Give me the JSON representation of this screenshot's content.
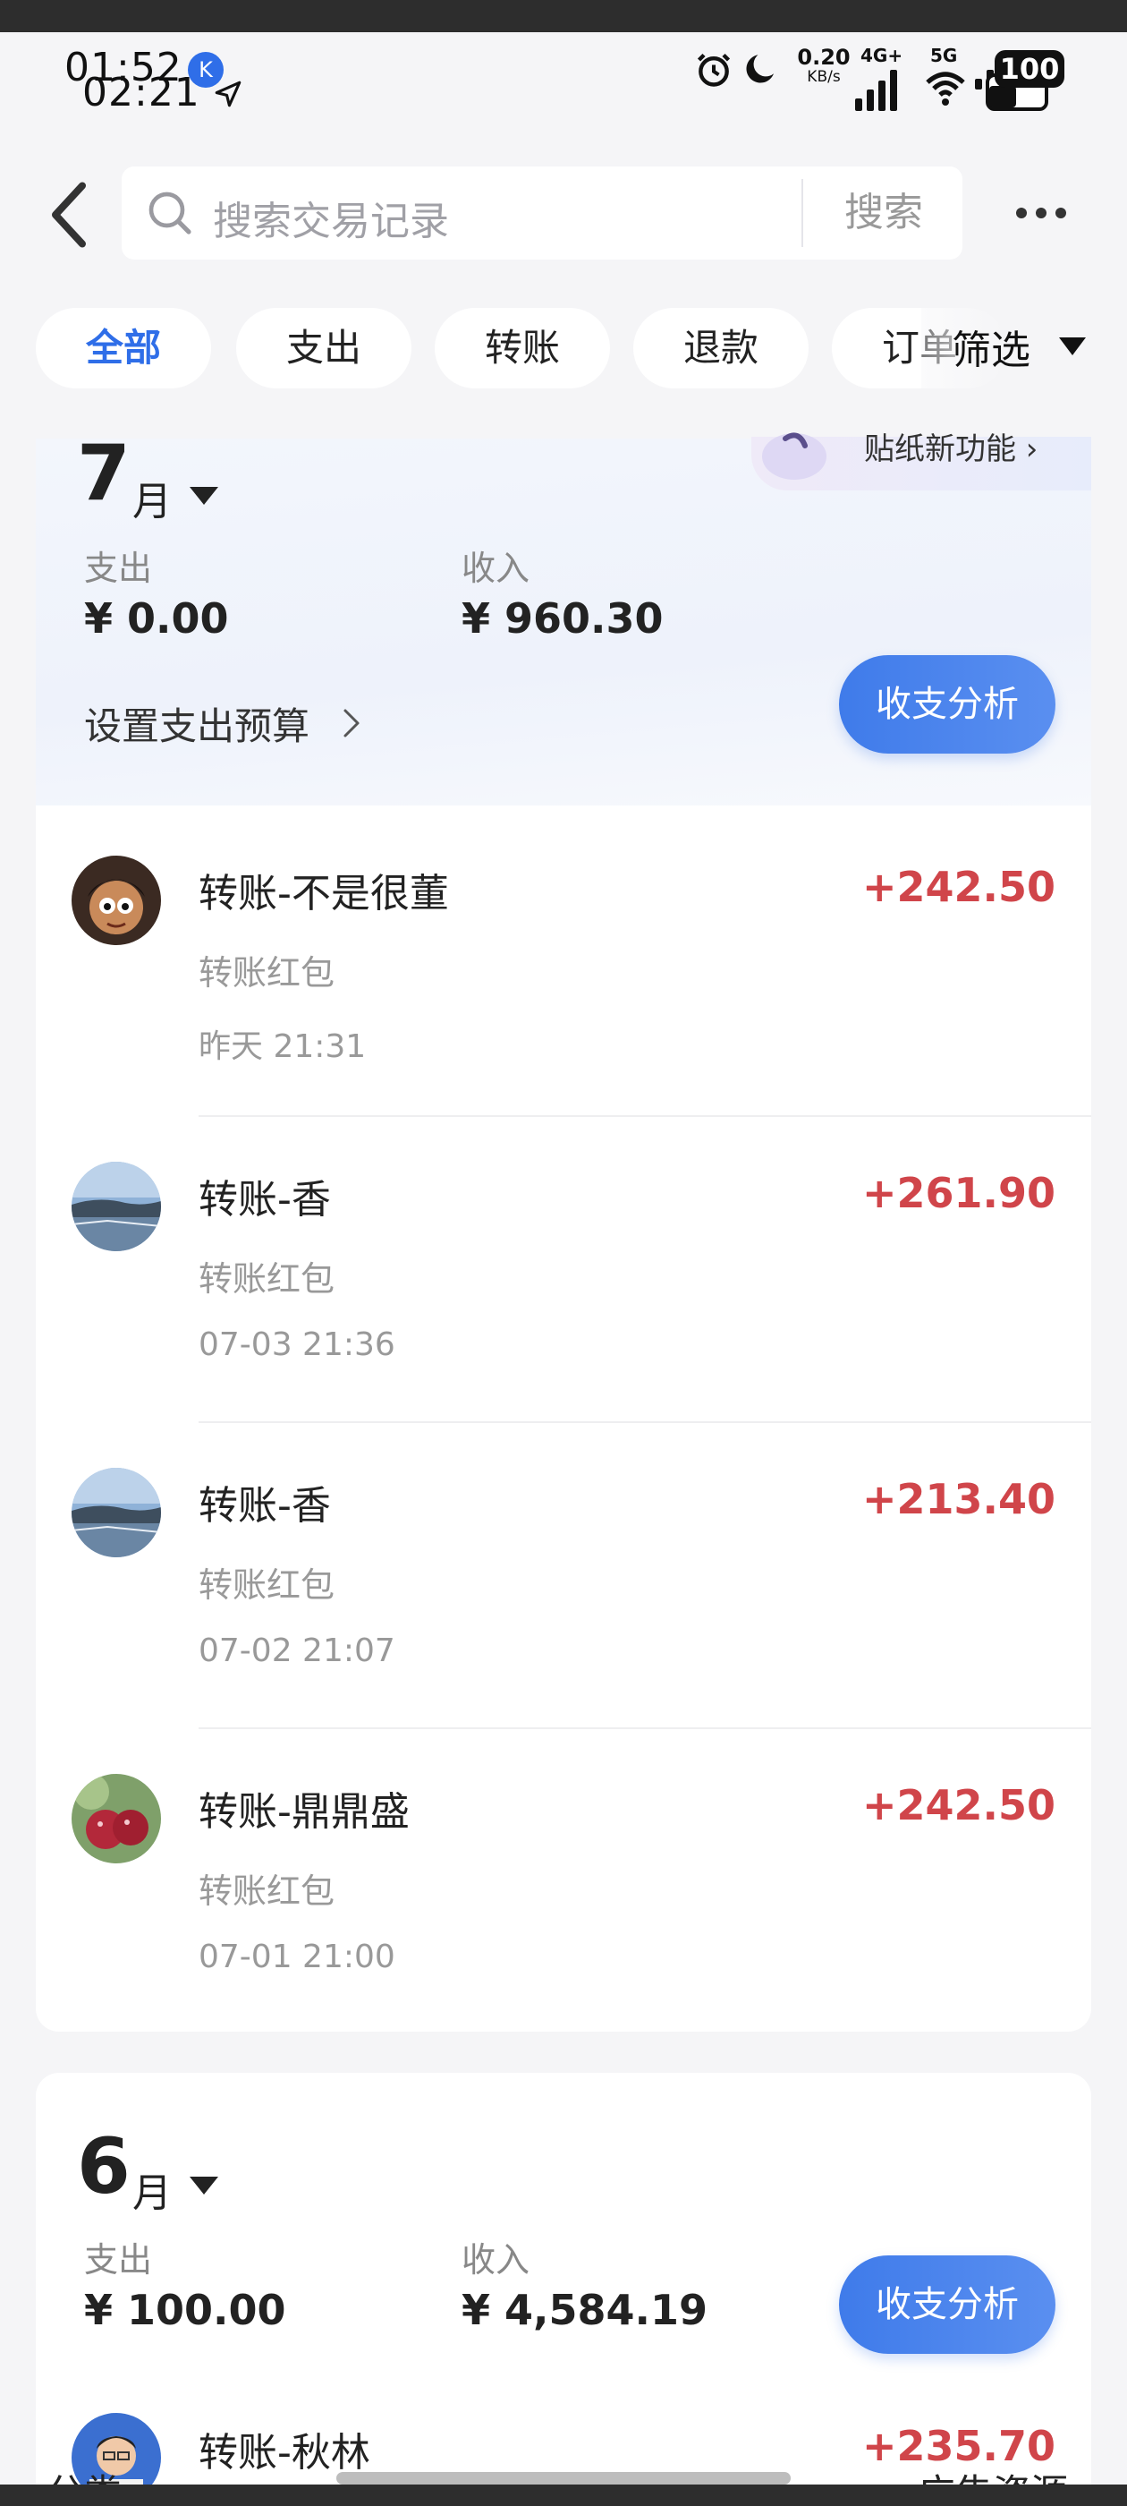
{
  "status_bar": {
    "time_primary": "01:52",
    "time_secondary": "02:21",
    "network_speed": "0.20",
    "network_unit": "KB/s",
    "signal_1": "4G+",
    "signal_2": "5G",
    "battery": "100"
  },
  "header": {
    "search_placeholder": "搜索交易记录",
    "search_button": "搜索"
  },
  "tabs": [
    {
      "label": "全部",
      "active": true
    },
    {
      "label": "支出",
      "active": false
    },
    {
      "label": "转账",
      "active": false
    },
    {
      "label": "退款",
      "active": false
    },
    {
      "label": "订单",
      "active": false
    }
  ],
  "filter_label": "筛选",
  "sticker_promo": "贴纸新功能",
  "months": [
    {
      "month": "7",
      "unit": "月",
      "expense_label": "支出",
      "expense": "¥ 0.00",
      "income_label": "收入",
      "income": "¥ 960.30",
      "budget_label": "设置支出预算",
      "analysis_button": "收支分析"
    },
    {
      "month": "6",
      "unit": "月",
      "expense_label": "支出",
      "expense": "¥ 100.00",
      "income_label": "收入",
      "income": "¥ 4,584.19",
      "analysis_button": "收支分析"
    }
  ],
  "transactions": [
    {
      "title": "转账-不是很董",
      "subtitle": "转账红包",
      "time": "昨天 21:31",
      "amount": "+242.50"
    },
    {
      "title": "转账-香",
      "subtitle": "转账红包",
      "time": "07-03 21:36",
      "amount": "+261.90"
    },
    {
      "title": "转账-香",
      "subtitle": "转账红包",
      "time": "07-02 21:07",
      "amount": "+213.40"
    },
    {
      "title": "转账-鼎鼎盛",
      "subtitle": "转账红包",
      "time": "07-01 21:00",
      "amount": "+242.50"
    },
    {
      "title": "转账-秋林",
      "amount": "+235.70"
    }
  ],
  "bottom_ghost": {
    "left": "分类",
    "right": "广告资源"
  },
  "colors": {
    "accent": "#2f6ee8",
    "income": "#d0454a"
  },
  "icons": [
    "back-icon",
    "search-icon",
    "more-icon",
    "caret-down-icon",
    "chevron-right-icon",
    "alarm-icon",
    "moon-icon",
    "wifi-icon"
  ]
}
